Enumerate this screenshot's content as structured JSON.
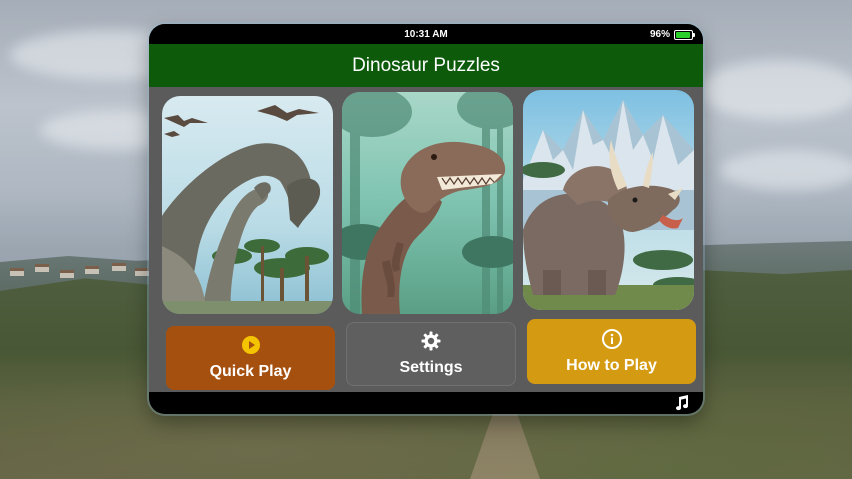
{
  "status_bar": {
    "time": "10:31 AM",
    "battery": "96%",
    "battery_level": 0.96,
    "battery_color": "#2bd12b"
  },
  "header": {
    "title": "Dinosaur Puzzles",
    "color": "#0d5a0b"
  },
  "puzzles": [
    {
      "subject": "Brachiosaurus"
    },
    {
      "subject": "Tyrannosaurus rex"
    },
    {
      "subject": "Triceratops"
    }
  ],
  "buttons": {
    "quick_play": {
      "label": "Quick Play",
      "icon": "play-circle-icon",
      "color": "#a6500f"
    },
    "settings": {
      "label": "Settings",
      "icon": "gear-icon",
      "color": "#5f5f5f"
    },
    "how_to_play": {
      "label": "How to Play",
      "icon": "info-icon",
      "color": "#d49a12"
    }
  },
  "bottom_bar": {
    "icon": "music-note-icon"
  }
}
